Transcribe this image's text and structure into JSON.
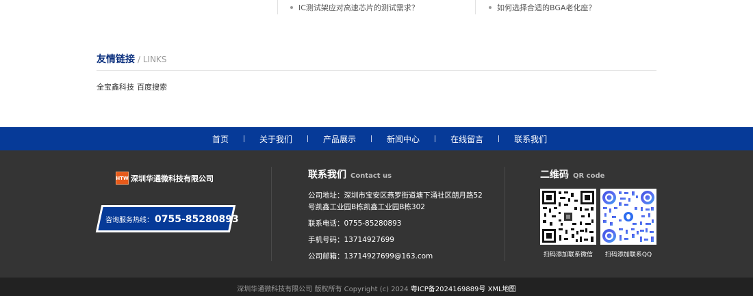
{
  "news": {
    "items": [
      {
        "title": "IC测试架应对高速芯片的测试需求？"
      },
      {
        "title": "如何选择合适的BGA老化座？"
      }
    ]
  },
  "links": {
    "title_cn": "友情链接",
    "title_en": "/ LINKS",
    "items": [
      "全宝鑫科技",
      "百度搜索"
    ]
  },
  "nav": {
    "items": [
      "首页",
      "关于我们",
      "产品展示",
      "新闻中心",
      "在线留言",
      "联系我们"
    ]
  },
  "footer": {
    "logo_mark": "HTW",
    "company_name": "深圳华通微科技有限公司",
    "hotline_label": "咨询服务热线：",
    "hotline_number": "0755-85280893",
    "contact": {
      "title_cn": "联系我们",
      "title_en": "Contact us",
      "address_line1": "公司地址：深圳市宝安区燕罗街道塘下涌社区朗月路52",
      "address_line2": "号凯鑫工业园B栋凯鑫工业园B栋302",
      "phone": "联系电话：0755-85280893",
      "mobile": "手机号码：13714927699",
      "email": "公司邮箱：13714927699@163.com"
    },
    "qr": {
      "title_cn": "二维码",
      "title_en": "QR code",
      "wechat_caption": "扫码添加联系微信",
      "qq_caption": "扫码添加联系QQ"
    }
  },
  "copyright": {
    "text": "深圳华通微科技有限公司 版权所有 Copyright (c) 2024",
    "icp": "粤ICP备2024169889号",
    "sitemap": "XML地图"
  },
  "colors": {
    "brand_blue": "#063a98",
    "footer_bg": "#343434",
    "copyright_bg": "#222222",
    "logo_orange": "#e85a1a"
  }
}
